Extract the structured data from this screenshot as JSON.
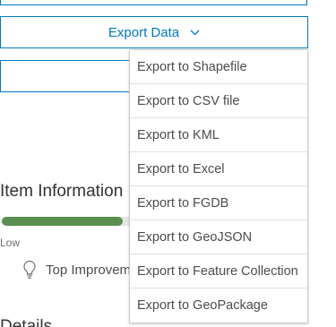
{
  "export_button": {
    "label": "Export Data",
    "icon": "chevron-down-icon"
  },
  "export_menu": {
    "items": [
      {
        "label": "Export to Shapefile"
      },
      {
        "label": "Export to CSV file"
      },
      {
        "label": "Export to KML"
      },
      {
        "label": "Export to Excel"
      },
      {
        "label": "Export to FGDB"
      },
      {
        "label": "Export to GeoJSON"
      },
      {
        "label": "Export to Feature Collection"
      },
      {
        "label": "Export to GeoPackage"
      }
    ]
  },
  "item_information": {
    "title": "Item Information",
    "progress_fraction": 0.9,
    "progress_label": "Low",
    "tip_text": "Top Improvements",
    "tip_icon": "lightbulb-icon"
  },
  "details": {
    "title": "Details"
  },
  "colors": {
    "accent": "#0079c1",
    "progress_fill": "#5a8f50",
    "progress_track": "#e6e6e6",
    "menu_border": "#cacaca"
  }
}
